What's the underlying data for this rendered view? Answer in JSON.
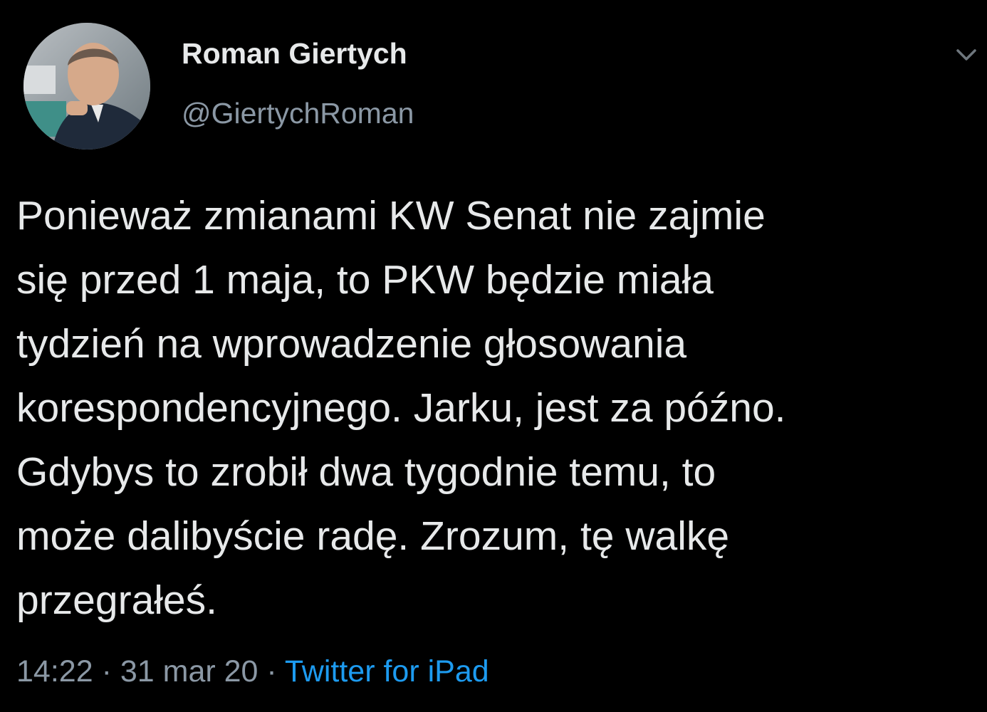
{
  "user": {
    "display_name": "Roman Giertych",
    "handle": "@GiertychRoman",
    "avatar_icon": "profile-photo"
  },
  "header": {
    "more_icon": "chevron-down-icon"
  },
  "tweet": {
    "lines": [
      "Ponieważ zmianami KW Senat nie zajmie",
      "się przed 1 maja, to PKW będzie miała",
      "tydzień na wprowadzenie głosowania",
      "korespondencyjnego. Jarku, jest za późno.",
      "Gdybys to zrobił dwa tygodnie temu, to",
      "może dalibyście radę. Zrozum, tę walkę",
      "przegrałeś."
    ]
  },
  "meta": {
    "time": "14:22",
    "separator": "·",
    "date": "31 mar 20",
    "source": "Twitter for iPad"
  },
  "colors": {
    "background": "#000000",
    "text_primary": "#e7e9ea",
    "text_secondary": "#8b98a5",
    "link": "#1d9bf0"
  }
}
